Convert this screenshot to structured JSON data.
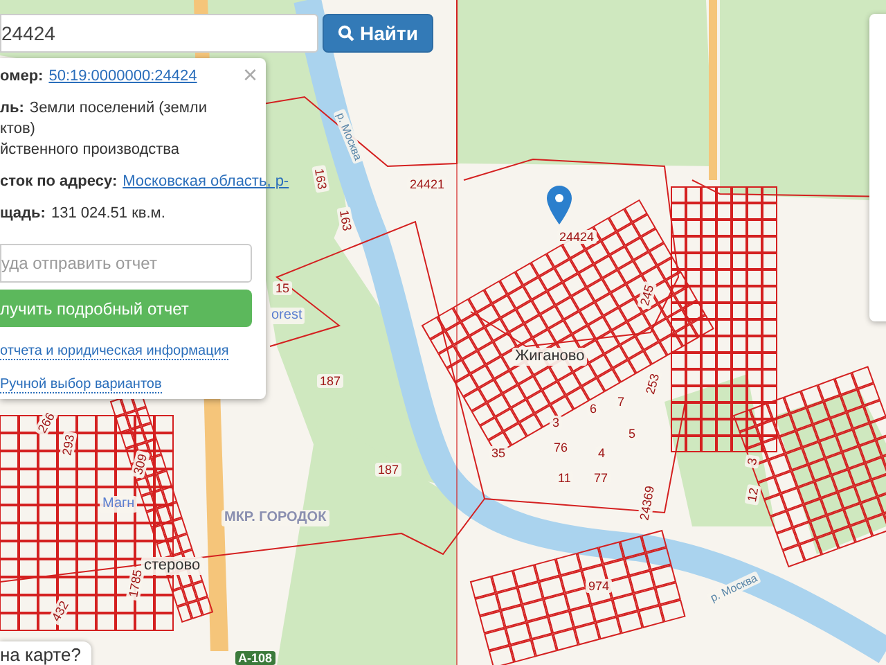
{
  "search": {
    "value": "24424",
    "button": "Найти"
  },
  "info_card": {
    "fields": [
      {
        "label": "омер:",
        "value": "50:19:0000000:24424",
        "kind": "link"
      },
      {
        "label": "ль:",
        "value": "Земли поселений (земли",
        "kind": "text",
        "more": [
          "ктов)",
          "йственного производства"
        ]
      },
      {
        "label": "сток по адресу:",
        "value": "Московская область, р-",
        "kind": "link"
      },
      {
        "label": "щадь:",
        "value": "131 024.51 кв.м.",
        "kind": "text"
      }
    ],
    "close": "×",
    "email_placeholder": "уда отправить отчет",
    "submit": "лучить подробный отчет",
    "links": [
      "отчета и юридическая информация",
      "Ручной выбор вариантов"
    ]
  },
  "map_labels": [
    {
      "text": "р. Москва",
      "kind": "river"
    },
    {
      "text": "163",
      "kind": "parcel"
    },
    {
      "text": "163",
      "kind": "parcel"
    },
    {
      "text": "24421",
      "kind": "parcel"
    },
    {
      "text": "24424",
      "kind": "parcel"
    },
    {
      "text": "15",
      "kind": "parcel"
    },
    {
      "text": "orest",
      "kind": "poi"
    },
    {
      "text": "187",
      "kind": "parcel"
    },
    {
      "text": "187",
      "kind": "parcel"
    },
    {
      "text": "Жиганово",
      "kind": "place"
    },
    {
      "text": "245",
      "kind": "parcel"
    },
    {
      "text": "253",
      "kind": "parcel"
    },
    {
      "text": "6",
      "kind": "parcel"
    },
    {
      "text": "7",
      "kind": "parcel"
    },
    {
      "text": "3",
      "kind": "parcel"
    },
    {
      "text": "5",
      "kind": "parcel"
    },
    {
      "text": "35",
      "kind": "parcel"
    },
    {
      "text": "76",
      "kind": "parcel"
    },
    {
      "text": "4",
      "kind": "parcel"
    },
    {
      "text": "11",
      "kind": "parcel"
    },
    {
      "text": "77",
      "kind": "parcel"
    },
    {
      "text": "24369",
      "kind": "parcel"
    },
    {
      "text": "3",
      "kind": "parcel"
    },
    {
      "text": "12",
      "kind": "parcel"
    },
    {
      "text": "974",
      "kind": "parcel"
    },
    {
      "text": "р. Москва",
      "kind": "river"
    },
    {
      "text": "266",
      "kind": "parcel"
    },
    {
      "text": "293",
      "kind": "parcel"
    },
    {
      "text": "309",
      "kind": "parcel"
    },
    {
      "text": "Магн",
      "kind": "poi"
    },
    {
      "text": "МКР. ГОРОДОК",
      "kind": "district"
    },
    {
      "text": "1785",
      "kind": "parcel"
    },
    {
      "text": "стерово",
      "kind": "place"
    },
    {
      "text": "432",
      "kind": "parcel"
    },
    {
      "text": "А-108",
      "kind": "road"
    }
  ],
  "bottom_hint": "на карте?"
}
